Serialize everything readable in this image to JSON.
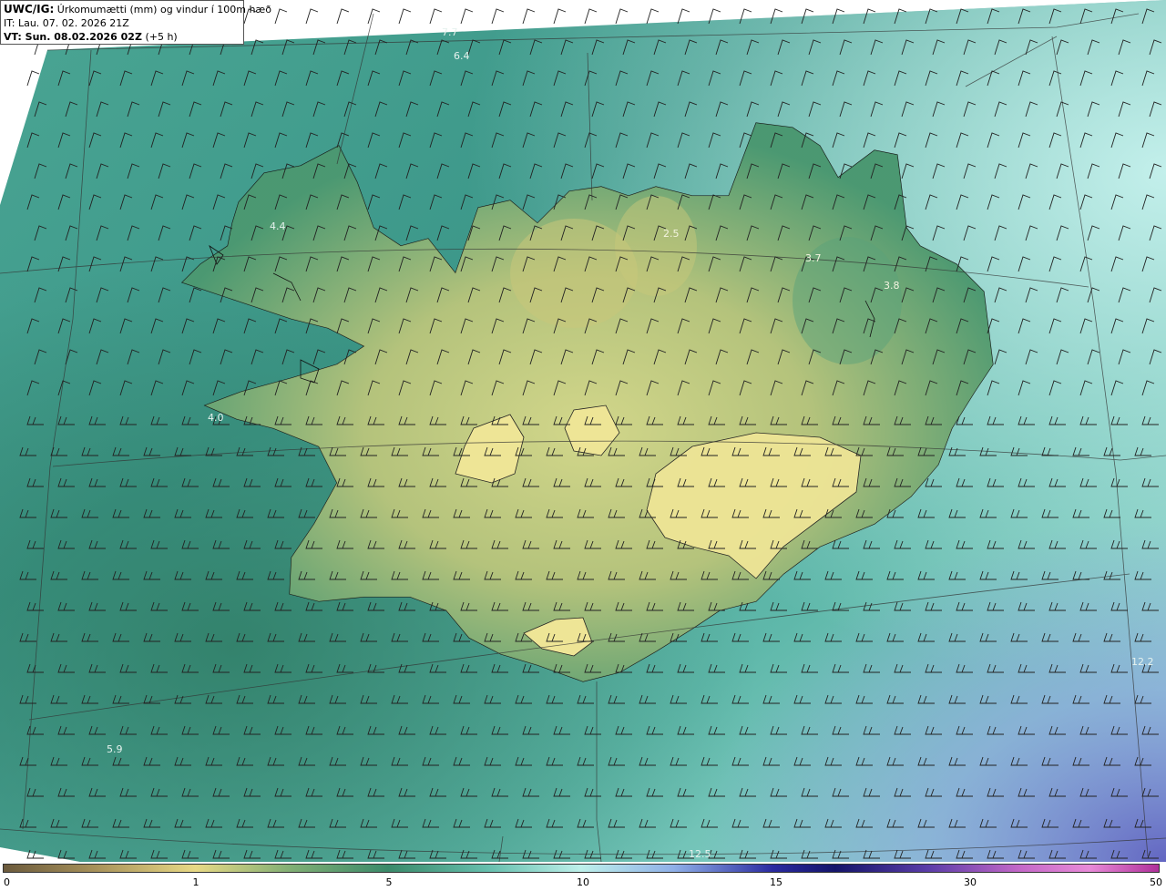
{
  "header": {
    "model": "UWC/IG:",
    "title": "Úrkomumætti (mm) og vindur í 100m hæð",
    "it_label": "IT: Lau. 07. 02. 2026 21Z",
    "vt_label": "VT: Sun. 08.02.2026 02Z",
    "vt_offset": "(+5 h)"
  },
  "colorbar": {
    "ticks": [
      "0",
      "1",
      "5",
      "10",
      "15",
      "30",
      "50"
    ]
  },
  "map_labels": [
    "7.7",
    "6.4",
    "4.4",
    "2.5",
    "3.7",
    "3.8",
    "4.0",
    "5.9",
    "12.2",
    "12.5"
  ],
  "colors": {
    "ocean_teal": "#3f9e8e",
    "land_green": "#2f7a63",
    "highland_yellow": "#e6dc86",
    "light_cyan": "#b8ece6",
    "blue_purple": "#6a6fc8",
    "coast_line": "#1a1a1a"
  }
}
